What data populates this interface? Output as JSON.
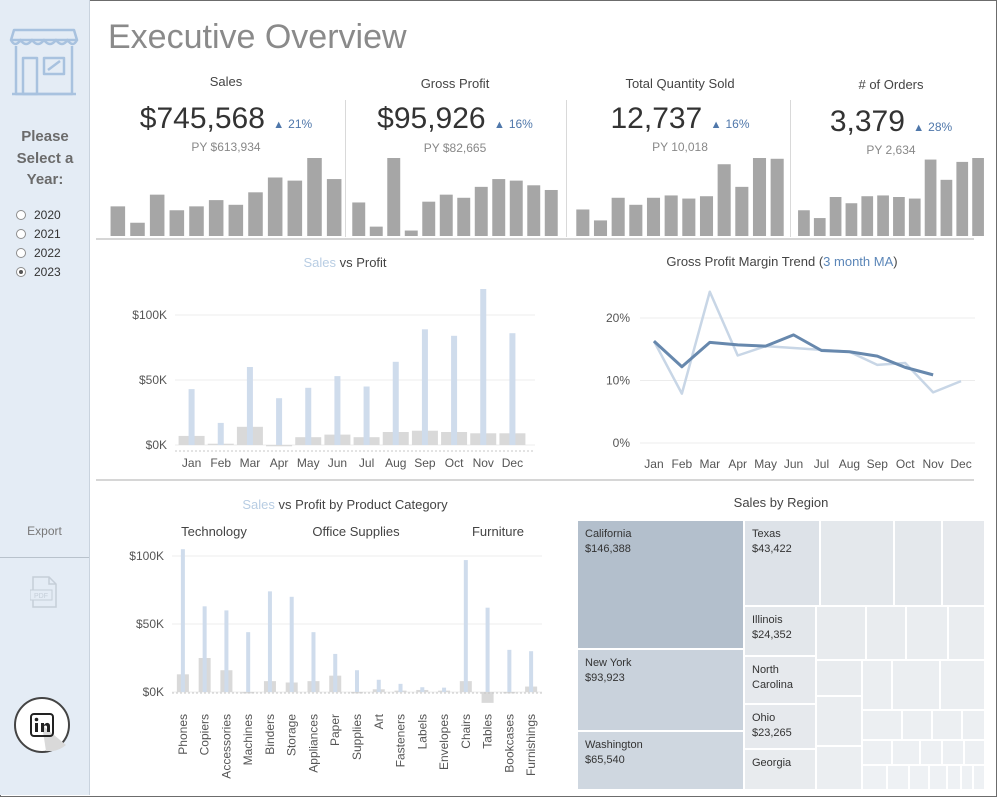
{
  "title": "Executive Overview",
  "sidebar": {
    "prompt": "Please Select a Year:",
    "years": [
      "2020",
      "2021",
      "2022",
      "2023"
    ],
    "selected_year": "2023",
    "export_label": "Export",
    "icons": [
      "storefront-icon",
      "pdf-icon",
      "linkedin-icon"
    ]
  },
  "kpis": [
    {
      "label": "Sales",
      "value": "$745,568",
      "change": "21%",
      "py": "PY $613,934",
      "bars": [
        0.38,
        0.17,
        0.53,
        0.33,
        0.38,
        0.46,
        0.4,
        0.56,
        0.75,
        0.71,
        1.0,
        0.73
      ]
    },
    {
      "label": "Gross Profit",
      "value": "$95,926",
      "change": "16%",
      "py": "PY $82,665",
      "bars": [
        0.43,
        0.12,
        1.0,
        0.07,
        0.44,
        0.53,
        0.49,
        0.63,
        0.73,
        0.71,
        0.65,
        0.59
      ]
    },
    {
      "label": "Total Quantity Sold",
      "value": "12,737",
      "change": "16%",
      "py": "PY 10,018",
      "bars": [
        0.34,
        0.2,
        0.49,
        0.4,
        0.49,
        0.52,
        0.48,
        0.51,
        0.92,
        0.63,
        1.0,
        0.99
      ]
    },
    {
      "label": "# of Orders",
      "value": "3,379",
      "change": "28%",
      "py": "PY 2,634",
      "bars": [
        0.33,
        0.23,
        0.5,
        0.42,
        0.51,
        0.52,
        0.5,
        0.48,
        0.98,
        0.72,
        0.95,
        1.0
      ]
    }
  ],
  "sales_vs_profit": {
    "title_sales": "Sales",
    "title_rest": " vs Profit",
    "yticks": [
      "$100K",
      "$50K",
      "$0K"
    ],
    "chart_data": {
      "type": "bar",
      "categories": [
        "Jan",
        "Feb",
        "Mar",
        "Apr",
        "May",
        "Jun",
        "Jul",
        "Aug",
        "Sep",
        "Oct",
        "Nov",
        "Dec"
      ],
      "series": [
        {
          "name": "Sales",
          "values": [
            43000,
            17000,
            60000,
            36000,
            44000,
            53000,
            45000,
            64000,
            89000,
            84000,
            120000,
            86000
          ],
          "color": "#cfdcec"
        },
        {
          "name": "Profit",
          "values": [
            7000,
            1000,
            14000,
            -1000,
            6000,
            8000,
            6000,
            10000,
            11000,
            10000,
            9000,
            9000
          ],
          "color": "#d9d9d9"
        }
      ],
      "ylim": [
        -5000,
        125000
      ]
    }
  },
  "gpm_trend": {
    "title_main": "Gross Profit Margin Trend (",
    "title_accent": "3 month MA",
    "title_close": ")",
    "yticks": [
      "20%",
      "10%",
      "0%"
    ],
    "chart_data": {
      "type": "line",
      "x": [
        "Jan",
        "Feb",
        "Mar",
        "Apr",
        "May",
        "Jun",
        "Jul",
        "Aug",
        "Sep",
        "Oct",
        "Nov",
        "Dec"
      ],
      "series": [
        {
          "name": "Gross Profit Margin",
          "values": [
            16.3,
            7.9,
            24.2,
            14.0,
            15.5,
            15.2,
            14.9,
            14.6,
            12.5,
            12.8,
            8.1,
            9.9
          ],
          "color": "#c8d6e6"
        },
        {
          "name": "3 month MA",
          "values": [
            16.3,
            12.2,
            16.1,
            15.7,
            15.5,
            17.3,
            14.8,
            14.6,
            13.9,
            12.1,
            10.9,
            null
          ],
          "color": "#6788ad"
        }
      ],
      "ylim": [
        0,
        25
      ]
    }
  },
  "category_chart": {
    "title_sales": "Sales",
    "title_rest": " vs Profit by Product Category",
    "groups": [
      "Technology",
      "Office Supplies",
      "Furniture"
    ],
    "yticks": [
      "$100K",
      "$50K",
      "$0K"
    ],
    "chart_data": {
      "type": "bar",
      "categories": [
        "Phones",
        "Copiers",
        "Accessories",
        "Machines",
        "Binders",
        "Storage",
        "Appliances",
        "Paper",
        "Supplies",
        "Art",
        "Fasteners",
        "Labels",
        "Envelopes",
        "Chairs",
        "Tables",
        "Bookcases",
        "Furnishings"
      ],
      "series": [
        {
          "name": "Sales",
          "values": [
            105000,
            63000,
            60000,
            44000,
            74000,
            70000,
            44000,
            28000,
            16000,
            9000,
            6000,
            3500,
            3200,
            97000,
            62000,
            31000,
            30000
          ],
          "color": "#cfdcec"
        },
        {
          "name": "Profit",
          "values": [
            13000,
            25000,
            16000,
            -1000,
            8000,
            7000,
            8000,
            12000,
            -1000,
            2000,
            1000,
            1500,
            1000,
            8000,
            -8000,
            -1000,
            4000
          ],
          "color": "#d9d9d9"
        }
      ],
      "ylim": [
        -10000,
        110000
      ]
    }
  },
  "region": {
    "title": "Sales by Region",
    "chart_data": {
      "type": "treemap",
      "states": [
        {
          "name": "California",
          "value": "$146,388",
          "amount": 146388
        },
        {
          "name": "New York",
          "value": "$93,923",
          "amount": 93923
        },
        {
          "name": "Washington",
          "value": "$65,540",
          "amount": 65540
        },
        {
          "name": "Texas",
          "value": "$43,422",
          "amount": 43422
        },
        {
          "name": "Illinois",
          "value": "$24,352",
          "amount": 24352
        },
        {
          "name": "North Carolina",
          "value": "",
          "amount": null
        },
        {
          "name": "Ohio",
          "value": "$23,265",
          "amount": 23265
        },
        {
          "name": "Georgia",
          "value": "",
          "amount": null
        }
      ]
    }
  }
}
